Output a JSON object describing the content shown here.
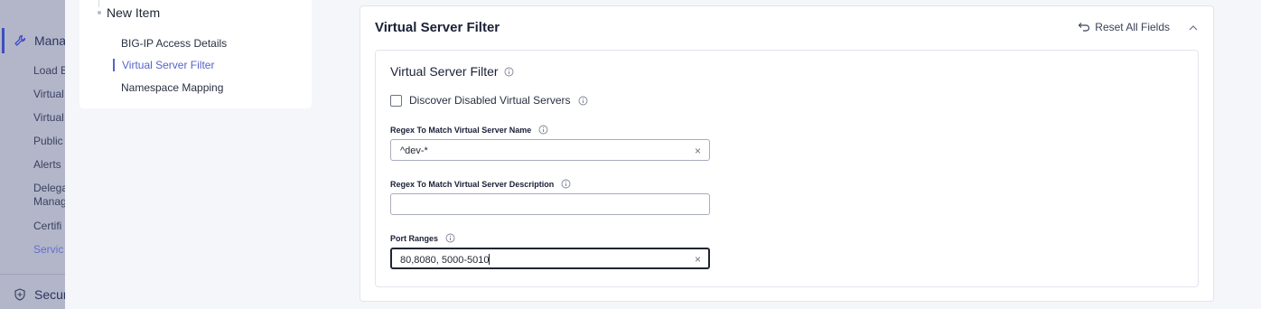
{
  "sidebar": {
    "sections": [
      {
        "label": "Mana",
        "icon": "wrench-icon"
      },
      {
        "label": "Secur",
        "icon": "shield-icon"
      }
    ],
    "items": [
      {
        "label": "Load B"
      },
      {
        "label": "Virtual"
      },
      {
        "label": "Virtual"
      },
      {
        "label": "Public"
      },
      {
        "label": "Alerts"
      },
      {
        "label": "Delega"
      },
      {
        "label": "Manag"
      },
      {
        "label": "Certifi"
      },
      {
        "label": "Servic"
      }
    ]
  },
  "outline": {
    "root": "New Item",
    "items": [
      {
        "label": "BIG-IP Access Details"
      },
      {
        "label": "Virtual Server Filter"
      },
      {
        "label": "Namespace Mapping"
      }
    ]
  },
  "card": {
    "title": "Virtual Server Filter",
    "reset_label": "Reset All Fields",
    "inner_title": "Virtual Server Filter",
    "checkbox_label": "Discover Disabled Virtual Servers",
    "fields": [
      {
        "label": "Regex To Match Virtual Server Name",
        "value": "^dev-*"
      },
      {
        "label": "Regex To Match Virtual Server Description",
        "value": ""
      },
      {
        "label": "Port Ranges",
        "value": "80,8080, 5000-5010"
      }
    ]
  },
  "colors": {
    "accent": "#5563c9",
    "sidebar_overlay": "#b3b6c9",
    "text": "#1f2533"
  }
}
